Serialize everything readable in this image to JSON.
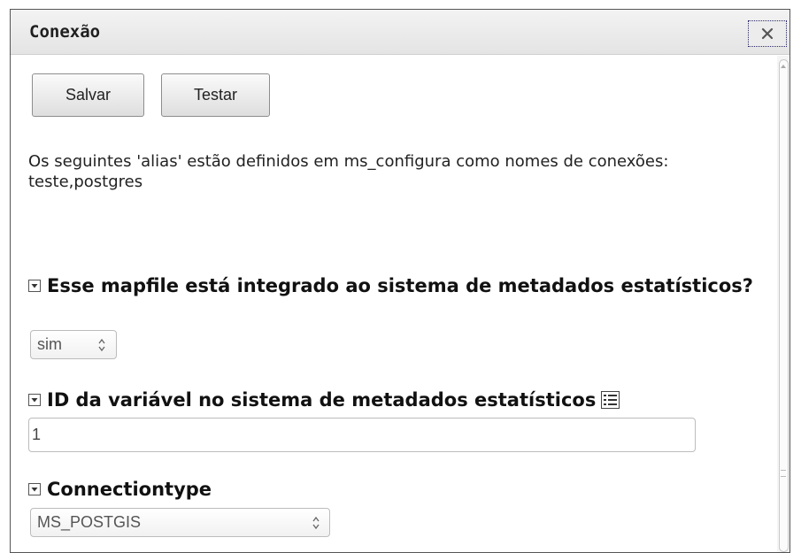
{
  "dialog": {
    "title": "Conexão",
    "close_label": "close"
  },
  "toolbar": {
    "save_label": "Salvar",
    "test_label": "Testar"
  },
  "info_text": "Os seguintes 'alias' estão definidos em ms_configura como nomes de conexões: teste,postgres",
  "fields": {
    "metadata": {
      "label": "Esse mapfile está integrado ao sistema de metadados estatísticos?",
      "value": "sim",
      "icon": "collapse-icon"
    },
    "variable_id": {
      "label": "ID da variável no sistema de metadados estatísticos",
      "value": "1",
      "icon": "collapse-icon",
      "list_icon": "list-icon"
    },
    "connectiontype": {
      "label": "Connectiontype",
      "value": "MS_POSTGIS",
      "icon": "collapse-icon"
    }
  }
}
